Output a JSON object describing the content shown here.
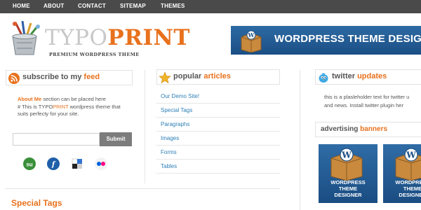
{
  "nav": {
    "items": [
      {
        "label": "HOME"
      },
      {
        "label": "ABOUT"
      },
      {
        "label": "CONTACT"
      },
      {
        "label": "SITEMAP"
      },
      {
        "label": "THEMES"
      }
    ]
  },
  "logo": {
    "part1": "TYPO",
    "part2": "PRINT",
    "tagline": "PREMIUM WORDPRESS THEME"
  },
  "banner": {
    "text": "WORDPRESS THEME DESIG"
  },
  "subscribe": {
    "title_plain": "subscribe to my ",
    "title_accent": "feed",
    "about_link": "About Me",
    "about_text1": " section can be placed here",
    "about_text2": "# This is TYPO",
    "about_accent": "PRINT",
    "about_text3": " wordpress theme that suits perfecty for your site.",
    "input_value": "",
    "submit_label": "Submit",
    "social_icons": [
      "stumbleupon-icon",
      "furl-icon",
      "delicious-icon",
      "flickr-icon"
    ]
  },
  "popular": {
    "title_plain": "popular ",
    "title_accent": "articles",
    "items": [
      {
        "label": "Our Demo Site!"
      },
      {
        "label": "Special Tags"
      },
      {
        "label": "Paragraphs"
      },
      {
        "label": "Images"
      },
      {
        "label": "Forms"
      },
      {
        "label": "Tables"
      }
    ]
  },
  "twitter": {
    "title_plain": "twitter ",
    "title_accent": "updates",
    "line1": "this is a plasleholder text for twitter u",
    "line2": "and news. Install twitter plugin her"
  },
  "ads": {
    "title_plain": "advertising ",
    "title_accent": "banners",
    "items": [
      {
        "line1": "WORDPRESS",
        "line2": "THEME",
        "line3": "DESIGNER"
      },
      {
        "line1": "WORDPRESS",
        "line2": "THEME",
        "line3": "DESIGNER"
      }
    ]
  },
  "special_tags": {
    "heading": "Special Tags"
  },
  "colors": {
    "accent": "#e8711d",
    "nav_bg": "#4a4a4a",
    "link": "#2d7fb6",
    "banner_blue": "#1b4f85"
  }
}
